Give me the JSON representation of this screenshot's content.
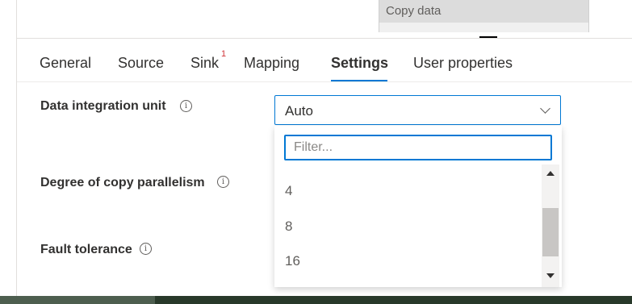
{
  "canvas": {
    "activity_title": "Copy data"
  },
  "tabs": [
    {
      "label": "General"
    },
    {
      "label": "Source"
    },
    {
      "label": "Sink",
      "badge": "1"
    },
    {
      "label": "Mapping"
    },
    {
      "label": "Settings",
      "active": true
    },
    {
      "label": "User properties"
    }
  ],
  "settings": {
    "data_integration_unit_label": "Data integration unit",
    "degree_of_copy_parallelism_label": "Degree of copy parallelism",
    "fault_tolerance_label": "Fault tolerance",
    "info_glyph": "i"
  },
  "diu_select": {
    "selected": "Auto",
    "filter_placeholder": "Filter...",
    "options": [
      "4",
      "8",
      "16"
    ]
  },
  "colors": {
    "accent": "#0078d4",
    "badge": "#d13438"
  },
  "icons": [
    "info-icon",
    "chevron-down-icon",
    "scroll-up-icon",
    "scroll-down-icon"
  ]
}
